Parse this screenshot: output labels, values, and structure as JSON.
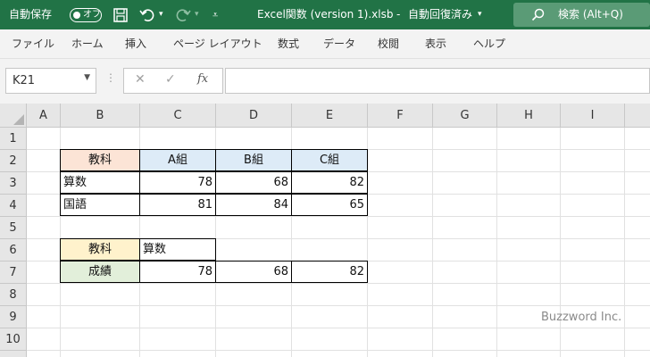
{
  "titlebar": {
    "autosave_label": "自動保存",
    "autosave_state": "オフ",
    "document_title": "Excel関数 (version 1).xlsb",
    "title_separator": "-",
    "save_status": "自動回復済み",
    "search_label": "検索 (Alt+Q)",
    "bg_color": "#217346"
  },
  "ribbon": {
    "tabs": [
      "ファイル",
      "ホーム",
      "挿入",
      "ページ レイアウト",
      "数式",
      "データ",
      "校閲",
      "表示",
      "ヘルプ"
    ]
  },
  "formula_bar": {
    "name_box": "K21",
    "fx": "fx",
    "content": ""
  },
  "grid": {
    "columns": [
      "A",
      "B",
      "C",
      "D",
      "E",
      "F",
      "G",
      "H",
      "I"
    ],
    "rows": [
      "1",
      "2",
      "3",
      "4",
      "5",
      "6",
      "7",
      "8",
      "9",
      "10"
    ],
    "header_fill": "#e6e6e6"
  },
  "table1": {
    "header": [
      "教科",
      "A組",
      "B組",
      "C組"
    ],
    "rows": [
      {
        "label": "算数",
        "values": [
          "78",
          "68",
          "82"
        ]
      },
      {
        "label": "国語",
        "values": [
          "81",
          "84",
          "65"
        ]
      }
    ],
    "label_header_fill": "#fce4d6",
    "col_header_fill": "#ddebf7"
  },
  "table2": {
    "subject_label": "教科",
    "subject_value": "算数",
    "score_label": "成績",
    "scores": [
      "78",
      "68",
      "82"
    ],
    "subject_fill": "#fff2cc",
    "score_fill": "#e2efda"
  },
  "watermark": "Buzzword Inc."
}
